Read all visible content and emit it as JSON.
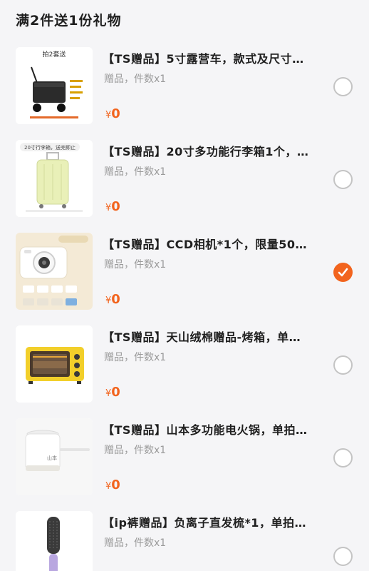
{
  "header": {
    "title": "满2件送1份礼物"
  },
  "items": [
    {
      "title": "【TS赠品】5寸露营车，款式及尺寸…",
      "subtitle": "赠品，件数x1",
      "currency": "¥",
      "price": "0",
      "selected": false,
      "thumb_icon": "camping-cart-icon",
      "thumb_text": "拍2套送"
    },
    {
      "title": "【TS赠品】20寸多功能行李箱1个，…",
      "subtitle": "赠品，件数x1",
      "currency": "¥",
      "price": "0",
      "selected": false,
      "thumb_icon": "luggage-icon",
      "thumb_text": "20寸行李箱，送完即止"
    },
    {
      "title": "【TS赠品】CCD相机*1个，限量50…",
      "subtitle": "赠品，件数x1",
      "currency": "¥",
      "price": "0",
      "selected": true,
      "thumb_icon": "camera-icon",
      "thumb_text": ""
    },
    {
      "title": "【TS赠品】天山绒棉赠品-烤箱，单…",
      "subtitle": "赠品，件数x1",
      "currency": "¥",
      "price": "0",
      "selected": false,
      "thumb_icon": "oven-icon",
      "thumb_text": ""
    },
    {
      "title": "【TS赠品】山本多功能电火锅，单拍…",
      "subtitle": "赠品，件数x1",
      "currency": "¥",
      "price": "0",
      "selected": false,
      "thumb_icon": "hot-pot-icon",
      "thumb_text": "山本"
    },
    {
      "title": "【ip裤赠品】负离子直发梳*1，单拍…",
      "subtitle": "赠品，件数x1",
      "currency": "¥",
      "price": "",
      "selected": false,
      "thumb_icon": "hair-brush-icon",
      "thumb_text": ""
    }
  ],
  "colors": {
    "accent": "#f2641e",
    "background": "#f5f5f7",
    "muted": "#9a9a9a"
  }
}
